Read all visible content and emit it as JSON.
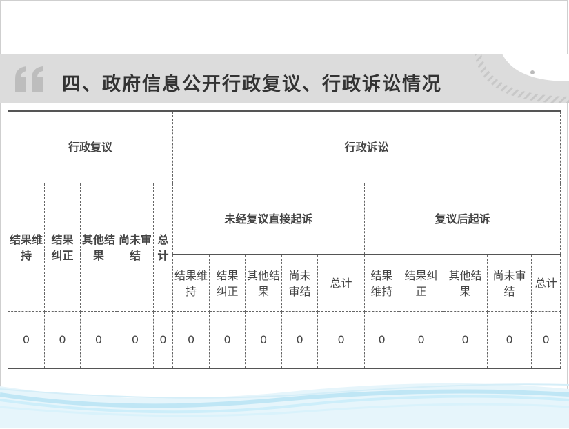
{
  "heading": {
    "title": "四、政府信息公开行政复议、行政诉讼情况"
  },
  "table": {
    "group_admin_review": "行政复议",
    "group_admin_litigation": "行政诉讼",
    "review_cols": [
      "结果维持",
      "结果纠正",
      "其他结果",
      "尚未审结",
      "总计"
    ],
    "sub_direct": "未经复议直接起诉",
    "sub_after_review": "复议后起诉",
    "direct_cols": [
      "结果维持",
      "结果纠正",
      "其他结果",
      "尚未审结",
      "总计"
    ],
    "after_cols": [
      "结果维持",
      "结果纠正",
      "其他结果",
      "尚未审结",
      "总计"
    ],
    "values": [
      "0",
      "0",
      "0",
      "0",
      "0",
      "0",
      "0",
      "0",
      "0",
      "0",
      "0",
      "0",
      "0",
      "0",
      "0"
    ]
  },
  "colors": {
    "band": "#dcdcdc",
    "title": "#333333",
    "border": "#666666",
    "wave": "#bfe6f5"
  }
}
